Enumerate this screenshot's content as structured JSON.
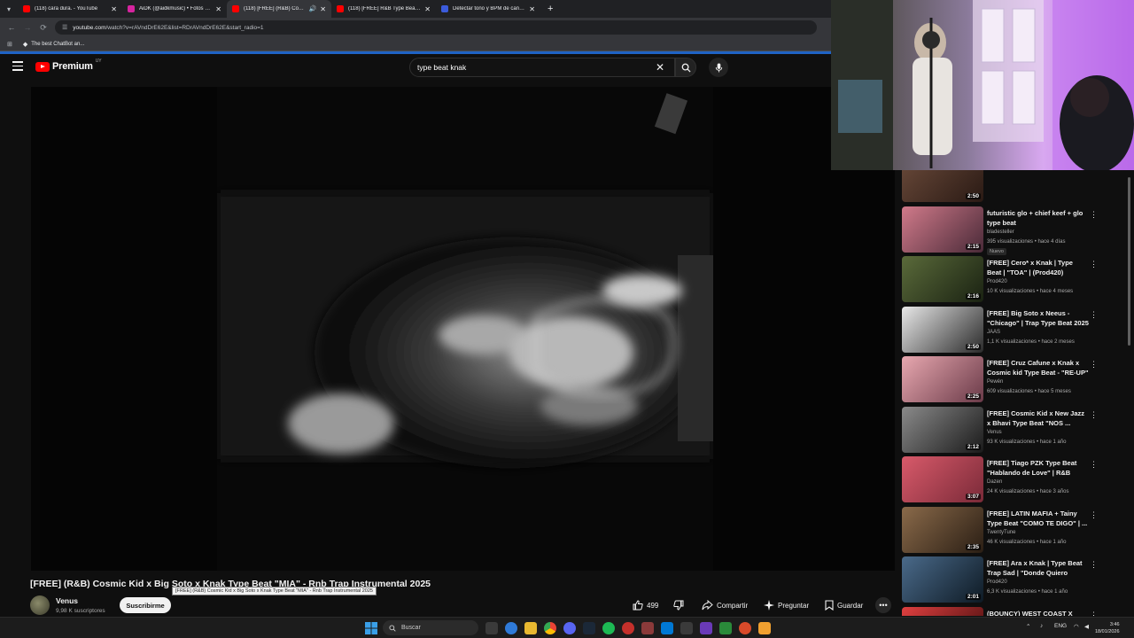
{
  "browser": {
    "tabs": [
      {
        "title": "(118) cara dura. - YouTube",
        "favicon_color": "#ff0000",
        "active": false
      },
      {
        "title": "AiDK (@aidkmusic) • Fotos y vi...",
        "favicon_color": "#d6249f",
        "active": false
      },
      {
        "title": "(118) [FREE] (R&B) Cosmic ...",
        "favicon_color": "#ff0000",
        "active": true
      },
      {
        "title": "(118) [FREE] R&B Type Beat - \"...",
        "favicon_color": "#ff0000",
        "active": false
      },
      {
        "title": "Detectar tono y BPM de canció...",
        "favicon_color": "#3b5bdb",
        "active": false
      }
    ],
    "url_domain": "youtube.com",
    "url_path": "/watch?v=rAVndDrE62E&list=RDrAVndDrE62E&start_radio=1",
    "bookmark": "The best ChatBot an..."
  },
  "header": {
    "logo": "Premium",
    "country": "UY",
    "search_value": "type beat knak"
  },
  "video": {
    "title": "[FREE] (R&B) Cosmic Kid x Big Soto x Knak Type Beat \"MIA\" - Rnb Trap Instrumental 2025",
    "tooltip": "[FREE] (R&B) Cosmic Kid x Big Soto x Knak Type Beat \"MIA\" - Rnb Trap Instrumental 2025",
    "channel": "Venus",
    "subscribers": "9,98 K suscriptores",
    "subscribe_label": "Suscribirme",
    "likes": "499",
    "share_label": "Compartir",
    "ask_label": "Preguntar",
    "save_label": "Guardar"
  },
  "recommendations": [
    {
      "title": "",
      "channel": "",
      "meta": "308 K visualizaciones • hace 7 meses",
      "duration": "2:50",
      "badge": "",
      "c1": "#6a4a3a",
      "c2": "#2a1a14"
    },
    {
      "title": "futuristic glo + chief keef + glo type beat",
      "channel": "bladesteller",
      "meta": "395 visualizaciones • hace 4 días",
      "duration": "2:15",
      "badge": "Nuevo",
      "c1": "#d07a8a",
      "c2": "#4a2a38"
    },
    {
      "title": "[FREE] Cero* x Knak | Type Beat | \"TOA\" | (Prod420)",
      "channel": "Prod420",
      "meta": "10 K visualizaciones • hace 4 meses",
      "duration": "2:16",
      "badge": "",
      "c1": "#5a6a3a",
      "c2": "#1a2212"
    },
    {
      "title": "[FREE] Big Soto x Neeus - \"Chicago\" | Trap Type Beat 2025",
      "channel": "JAAS",
      "meta": "1,1 K visualizaciones • hace 2 meses",
      "duration": "2:50",
      "badge": "",
      "c1": "#e8e8e8",
      "c2": "#2a2a2a"
    },
    {
      "title": "[FREE] Cruz Cafune x Knak x Cosmic kid Type Beat - \"RE-UP\"",
      "channel": "Pewén",
      "meta": "609 visualizaciones • hace 5 meses",
      "duration": "2:25",
      "badge": "",
      "c1": "#e8a8b0",
      "c2": "#6a3a48"
    },
    {
      "title": "[FREE] Cosmic Kid x New Jazz x Bhavi Type Beat \"NOS ...",
      "channel": "Venus",
      "meta": "93 K visualizaciones • hace 1 año",
      "duration": "2:12",
      "badge": "",
      "c1": "#8a8a8a",
      "c2": "#1a1a1a"
    },
    {
      "title": "[FREE] Tiago PZK Type Beat \"Hablando de Love\" | R&B Type...",
      "channel": "Dazen",
      "meta": "24 K visualizaciones • hace 3 años",
      "duration": "3:07",
      "badge": "",
      "c1": "#d85a6a",
      "c2": "#7a2a38"
    },
    {
      "title": "[FREE] LATIN MAFIA + Tainy Type Beat \"COMO TE DIGO\" | ...",
      "channel": "TwentyTune",
      "meta": "46 K visualizaciones • hace 1 año",
      "duration": "2:35",
      "badge": "",
      "c1": "#8a6a4a",
      "c2": "#2a1e14"
    },
    {
      "title": "[FREE] Ara x Knak | Type Beat Trap Sad | \"Donde Quiero Esta...",
      "channel": "Prod420",
      "meta": "6,3 K visualizaciones • hace 1 año",
      "duration": "2:01",
      "badge": "",
      "c1": "#4a6a8a",
      "c2": "#0e1a24"
    },
    {
      "title": "(BOUNCY) WEST COAST X REGGAETON X DETROIT ...",
      "channel": "jozke",
      "meta": "",
      "duration": "",
      "badge": "",
      "c1": "#e04040",
      "c2": "#3a0a0a"
    }
  ],
  "taskbar": {
    "search_placeholder": "Buscar",
    "language": "ENG",
    "time": "3:46",
    "date": "18/01/2026"
  }
}
